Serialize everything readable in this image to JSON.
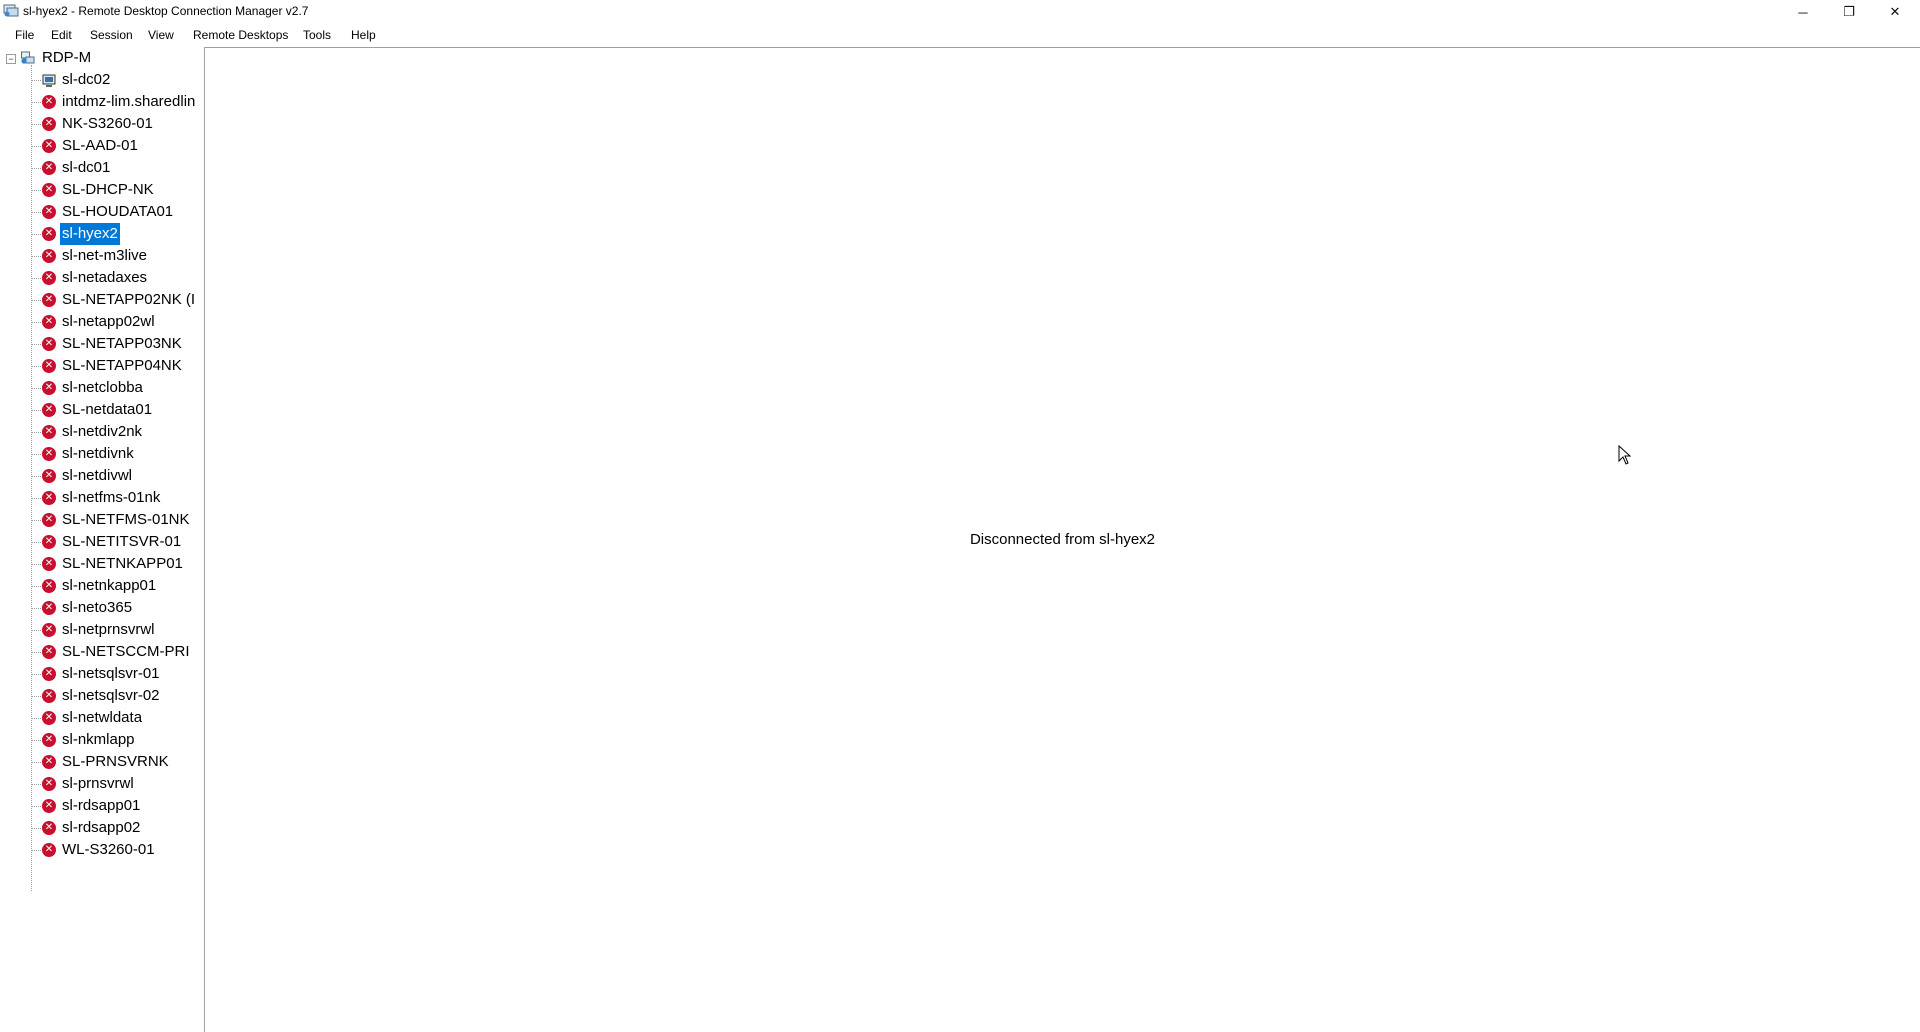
{
  "window": {
    "title": "sl-hyex2 - Remote Desktop Connection Manager v2.7",
    "minimize_glyph": "─",
    "maximize_glyph": "❐",
    "close_glyph": "✕"
  },
  "menu": {
    "items": [
      "File",
      "Edit",
      "Session",
      "View",
      "Remote Desktops",
      "Tools",
      "Help"
    ]
  },
  "tree": {
    "root": {
      "label": "RDP-M",
      "expander": "−",
      "icon": "server-group-icon"
    },
    "selected_index": 7,
    "servers": [
      {
        "label": "sl-dc02",
        "status": "connected",
        "icon": "computer-icon"
      },
      {
        "label": "intdmz-lim.sharedlin",
        "status": "error",
        "icon": "error-icon"
      },
      {
        "label": "NK-S3260-01",
        "status": "error",
        "icon": "error-icon"
      },
      {
        "label": "SL-AAD-01",
        "status": "error",
        "icon": "error-icon"
      },
      {
        "label": "sl-dc01",
        "status": "error",
        "icon": "error-icon"
      },
      {
        "label": "SL-DHCP-NK",
        "status": "error",
        "icon": "error-icon"
      },
      {
        "label": "SL-HOUDATA01",
        "status": "error",
        "icon": "error-icon"
      },
      {
        "label": "sl-hyex2",
        "status": "error",
        "icon": "error-icon"
      },
      {
        "label": "sl-net-m3live",
        "status": "error",
        "icon": "error-icon"
      },
      {
        "label": "sl-netadaxes",
        "status": "error",
        "icon": "error-icon"
      },
      {
        "label": "SL-NETAPP02NK (I",
        "status": "error",
        "icon": "error-icon"
      },
      {
        "label": "sl-netapp02wl",
        "status": "error",
        "icon": "error-icon"
      },
      {
        "label": "SL-NETAPP03NK",
        "status": "error",
        "icon": "error-icon"
      },
      {
        "label": "SL-NETAPP04NK",
        "status": "error",
        "icon": "error-icon"
      },
      {
        "label": "sl-netclobba",
        "status": "error",
        "icon": "error-icon"
      },
      {
        "label": "SL-netdata01",
        "status": "error",
        "icon": "error-icon"
      },
      {
        "label": "sl-netdiv2nk",
        "status": "error",
        "icon": "error-icon"
      },
      {
        "label": "sl-netdivnk",
        "status": "error",
        "icon": "error-icon"
      },
      {
        "label": "sl-netdivwl",
        "status": "error",
        "icon": "error-icon"
      },
      {
        "label": "sl-netfms-01nk",
        "status": "error",
        "icon": "error-icon"
      },
      {
        "label": "SL-NETFMS-01NK",
        "status": "error",
        "icon": "error-icon"
      },
      {
        "label": "SL-NETITSVR-01",
        "status": "error",
        "icon": "error-icon"
      },
      {
        "label": "SL-NETNKAPP01",
        "status": "error",
        "icon": "error-icon"
      },
      {
        "label": "sl-netnkapp01",
        "status": "error",
        "icon": "error-icon"
      },
      {
        "label": "sl-neto365",
        "status": "error",
        "icon": "error-icon"
      },
      {
        "label": "sl-netprnsvrwl",
        "status": "error",
        "icon": "error-icon"
      },
      {
        "label": "SL-NETSCCM-PRI",
        "status": "error",
        "icon": "error-icon"
      },
      {
        "label": "sl-netsqlsvr-01",
        "status": "error",
        "icon": "error-icon"
      },
      {
        "label": "sl-netsqlsvr-02",
        "status": "error",
        "icon": "error-icon"
      },
      {
        "label": "sl-netwldata",
        "status": "error",
        "icon": "error-icon"
      },
      {
        "label": "sl-nkmlapp",
        "status": "error",
        "icon": "error-icon"
      },
      {
        "label": "SL-PRNSVRNK",
        "status": "error",
        "icon": "error-icon"
      },
      {
        "label": "sl-prnsvrwl",
        "status": "error",
        "icon": "error-icon"
      },
      {
        "label": "sl-rdsapp01",
        "status": "error",
        "icon": "error-icon"
      },
      {
        "label": "sl-rdsapp02",
        "status": "error",
        "icon": "error-icon"
      },
      {
        "label": "WL-S3260-01",
        "status": "error",
        "icon": "error-icon"
      }
    ]
  },
  "content": {
    "message": "Disconnected from sl-hyex2"
  },
  "colors": {
    "selection": "#0078d7",
    "error": "#c8102e"
  }
}
